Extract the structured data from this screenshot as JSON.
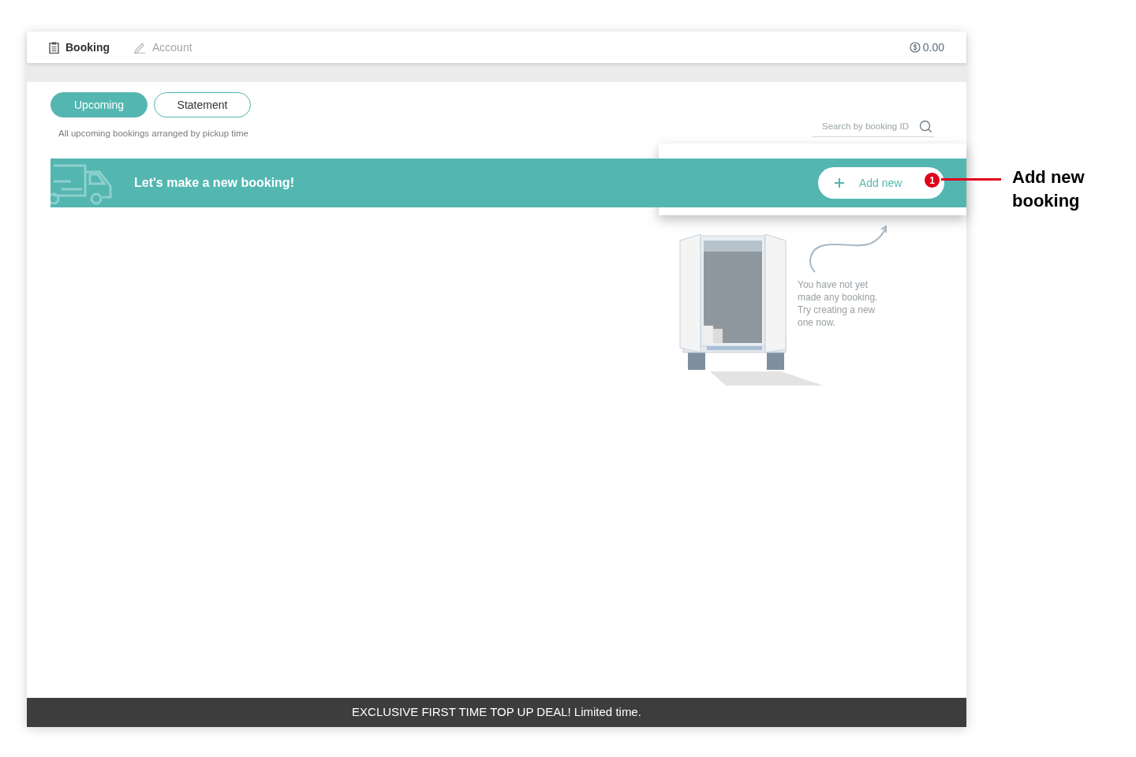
{
  "nav": {
    "tabs": [
      {
        "label": "Booking",
        "selected": true
      },
      {
        "label": "Account",
        "selected": false
      }
    ],
    "balance": "0.00"
  },
  "filters": {
    "tabs": [
      {
        "label": "Upcoming",
        "selected": true
      },
      {
        "label": "Statement",
        "selected": false
      }
    ],
    "caption": "All upcoming bookings arranged by pickup time"
  },
  "search": {
    "placeholder": "Search by booking ID"
  },
  "banner": {
    "title": "Let's make a new booking!",
    "button": "Add new"
  },
  "empty_state": {
    "message": "You have not yet made any booking. Try creating a new one now."
  },
  "promo_bar": {
    "text": "EXCLUSIVE FIRST TIME TOP UP DEAL! Limited time."
  },
  "annotation": {
    "number": "1",
    "label": "Add new booking"
  }
}
